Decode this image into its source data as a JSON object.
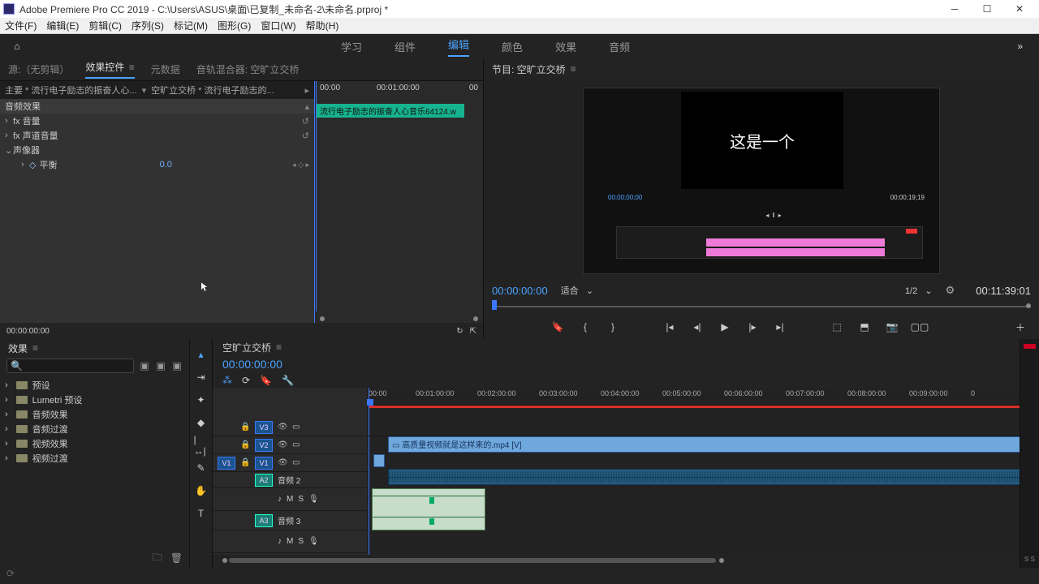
{
  "titlebar": {
    "app": "Adobe Premiere Pro CC 2019 - C:\\Users\\ASUS\\桌面\\已复制_未命名-2\\未命名.prproj *"
  },
  "menus": [
    "文件(F)",
    "编辑(E)",
    "剪辑(C)",
    "序列(S)",
    "标记(M)",
    "图形(G)",
    "窗口(W)",
    "帮助(H)"
  ],
  "workspace_tabs": {
    "items": [
      "学习",
      "组件",
      "编辑",
      "颜色",
      "效果",
      "音频"
    ],
    "active_index": 2
  },
  "source_tabs": {
    "items": [
      "源:（无剪辑）",
      "效果控件",
      "元数据",
      "音轨混合器: 空旷立交桥"
    ],
    "active_index": 1
  },
  "effect_controls": {
    "clip_header": "主要 * 流行电子励志的振奋人心...",
    "seq_link": "空旷立交桥 * 流行电子励志的...",
    "section": "音频效果",
    "rows": [
      {
        "label": "fx 音量"
      },
      {
        "label": "fx 声道音量"
      },
      {
        "label": "声像器",
        "expanded": true
      },
      {
        "label": "平衡",
        "indent": true,
        "value": "0.0"
      }
    ],
    "time_start": "00:00",
    "time_mid": "00:01:00:00",
    "time_end": "00",
    "clip_label": "流行电子励志的振奋人心音乐64124.w",
    "footer_time": "00:00:00:00"
  },
  "program": {
    "title": "节目: 空旷立交桥",
    "overlay_text": "这是一个",
    "mini_time": "00;00;00;00",
    "mini_dur": "00;00;19;19",
    "current_time": "00:00:00:00",
    "fit": "适合",
    "scale": "1/2",
    "duration": "00:11:39:01"
  },
  "effects_panel": {
    "title": "效果",
    "tree": [
      "预设",
      "Lumetri 预设",
      "音频效果",
      "音频过渡",
      "视频效果",
      "视频过渡"
    ]
  },
  "timeline": {
    "title": "空旷立交桥",
    "current_time": "00:00:00:00",
    "ruler_ticks": [
      "00:00",
      "00:01:00:00",
      "00:02:00:00",
      "00:03:00:00",
      "00:04:00:00",
      "00:05:00:00",
      "00:06:00:00",
      "00:07:00:00",
      "00:08:00:00",
      "00:09:00:00",
      "0"
    ],
    "tracks": {
      "V3": "V3",
      "V2": "V2",
      "V1": "V1",
      "A1": "V1",
      "A2": "A2",
      "A2_label": "音频 2",
      "A3": "A3",
      "A3_label": "音频 3"
    },
    "clip_video": "高质量视频就是这样来的.mp4 [V]",
    "src_patch": "V1"
  },
  "meters_label": "S  S"
}
